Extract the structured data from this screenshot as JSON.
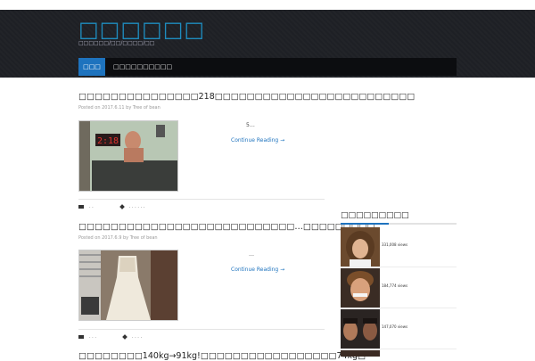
{
  "header": {
    "site_title": "□□□□□□",
    "tagline": "□□□□□□/□□/□□□□/□□"
  },
  "nav": {
    "items": [
      {
        "label": "□□□"
      },
      {
        "label": "□□□□□□□□□□"
      }
    ]
  },
  "posts": [
    {
      "title": "□□□□□□□□□□□□□□□218□□□□□□□□□□□□□□□□□□□□□□□□□",
      "meta": "Posted on 2017.6.11  by Tree of bean",
      "excerpt": "5…",
      "read_more": "Continue Reading →",
      "footer_categories": ". .",
      "footer_tags": ". . . . . ."
    },
    {
      "title": "□□□□□□□□□□□□□□□□□□□□□□□□□□□…□□□□□□□□□",
      "meta": "Posted on 2017.6.9  by Tree of bean",
      "excerpt": "…",
      "read_more": "Continue Reading →",
      "footer_categories": ". . .",
      "footer_tags": ". . . ."
    },
    {
      "title": "□□□□□□□□140kg→91kg!□□□□□□□□□□□□□□□□□74kg□"
    }
  ],
  "sidebar": {
    "popular_title": "□□□□□□□□□",
    "popular_posts": [
      {
        "views": "331,008 views"
      },
      {
        "views": "184,774 views"
      },
      {
        "views": "147,070 views"
      }
    ]
  },
  "colors": {
    "accent": "#1e73be",
    "title_blue": "#1e8cbe",
    "header_bg": "#1f2126",
    "nav_bg": "#0c0d10"
  }
}
